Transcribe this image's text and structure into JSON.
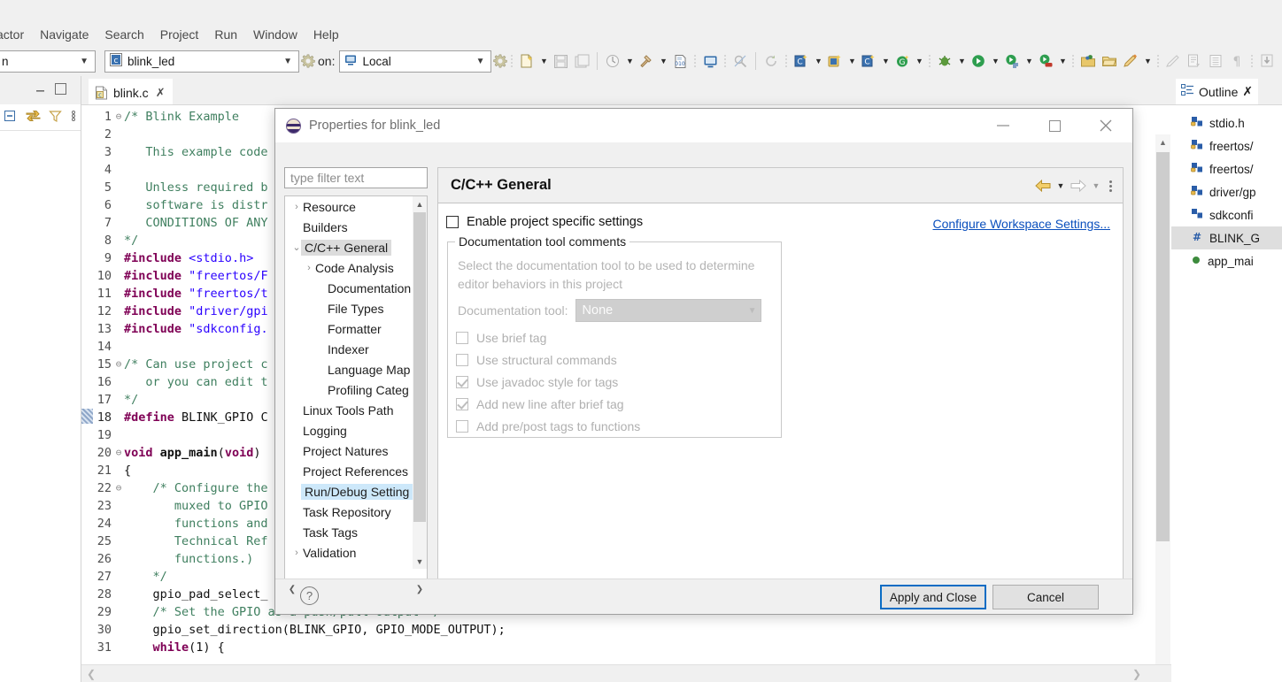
{
  "menubar": {
    "items": [
      "actor",
      "Navigate",
      "Search",
      "Project",
      "Run",
      "Window",
      "Help"
    ]
  },
  "toolbar": {
    "perspective_combo_value": "n",
    "launch_combo_value": "blink_led",
    "on_label": "on:",
    "target_combo_value": "Local",
    "icons": [
      "new-file-icon",
      "save-icon",
      "save-all-icon",
      "quick-access-icon",
      "build-hammer-icon",
      "binary-icon",
      "console-icon",
      "search-disabled-icon",
      "refresh-icon",
      "new-c-project-icon",
      "new-c-class-icon",
      "new-c-file-icon",
      "new-generic-icon",
      "debug-bug-icon",
      "run-icon",
      "run-config-icon",
      "stop-record-icon",
      "open-type-icon",
      "open-folder-icon",
      "pencil-icon",
      "highlight-icon",
      "export-icon",
      "list-icon",
      "pilcrow-icon",
      "download-icon"
    ]
  },
  "left_pane": {
    "tools": [
      "collapse-all-icon",
      "link-with-editor-icon",
      "filter-icon",
      "view-menu-icon"
    ],
    "window_buttons": [
      "minimize-icon",
      "maximize-icon"
    ]
  },
  "editor": {
    "tab_label": "blink.c",
    "tab_close": "✗",
    "file_icon": "c-file-icon",
    "lines": [
      {
        "n": 1,
        "fold": "⊖",
        "segs": [
          {
            "t": "/* Blink Example",
            "c": "cm"
          }
        ]
      },
      {
        "n": 2,
        "fold": "",
        "segs": []
      },
      {
        "n": 3,
        "fold": "",
        "segs": [
          {
            "t": "   This example code",
            "c": "cm"
          }
        ]
      },
      {
        "n": 4,
        "fold": "",
        "segs": []
      },
      {
        "n": 5,
        "fold": "",
        "segs": [
          {
            "t": "   Unless required b",
            "c": "cm"
          }
        ]
      },
      {
        "n": 6,
        "fold": "",
        "segs": [
          {
            "t": "   software is distr",
            "c": "cm"
          }
        ]
      },
      {
        "n": 7,
        "fold": "",
        "segs": [
          {
            "t": "   CONDITIONS OF ANY",
            "c": "cm"
          }
        ]
      },
      {
        "n": 8,
        "fold": "",
        "segs": [
          {
            "t": "*/",
            "c": "cm"
          }
        ]
      },
      {
        "n": 9,
        "fold": "",
        "segs": [
          {
            "t": "#include",
            "c": "pp"
          },
          {
            "t": " ",
            "c": ""
          },
          {
            "t": "<stdio.h>",
            "c": "str"
          }
        ]
      },
      {
        "n": 10,
        "fold": "",
        "segs": [
          {
            "t": "#include",
            "c": "pp"
          },
          {
            "t": " ",
            "c": ""
          },
          {
            "t": "\"freertos/F",
            "c": "str"
          }
        ]
      },
      {
        "n": 11,
        "fold": "",
        "segs": [
          {
            "t": "#include",
            "c": "pp"
          },
          {
            "t": " ",
            "c": ""
          },
          {
            "t": "\"freertos/t",
            "c": "str"
          }
        ]
      },
      {
        "n": 12,
        "fold": "",
        "segs": [
          {
            "t": "#include",
            "c": "pp"
          },
          {
            "t": " ",
            "c": ""
          },
          {
            "t": "\"driver/gpi",
            "c": "str"
          }
        ]
      },
      {
        "n": 13,
        "fold": "",
        "segs": [
          {
            "t": "#include",
            "c": "pp"
          },
          {
            "t": " ",
            "c": ""
          },
          {
            "t": "\"sdkconfig.",
            "c": "str"
          }
        ]
      },
      {
        "n": 14,
        "fold": "",
        "segs": []
      },
      {
        "n": 15,
        "fold": "⊖",
        "segs": [
          {
            "t": "/* Can use project c",
            "c": "cm"
          }
        ]
      },
      {
        "n": 16,
        "fold": "",
        "segs": [
          {
            "t": "   or you can edit t",
            "c": "cm"
          }
        ]
      },
      {
        "n": 17,
        "fold": "",
        "segs": [
          {
            "t": "*/",
            "c": "cm"
          }
        ]
      },
      {
        "n": 18,
        "fold": "",
        "current": true,
        "segs": [
          {
            "t": "#define",
            "c": "pp"
          },
          {
            "t": " BLINK_GPIO C",
            "c": ""
          }
        ]
      },
      {
        "n": 19,
        "fold": "",
        "segs": []
      },
      {
        "n": 20,
        "fold": "⊖",
        "segs": [
          {
            "t": "void",
            "c": "kw"
          },
          {
            "t": " ",
            "c": ""
          },
          {
            "t": "app_main",
            "c": "fn"
          },
          {
            "t": "(",
            "c": ""
          },
          {
            "t": "void",
            "c": "kw"
          },
          {
            "t": ")",
            "c": ""
          }
        ]
      },
      {
        "n": 21,
        "fold": "",
        "segs": [
          {
            "t": "{",
            "c": ""
          }
        ]
      },
      {
        "n": 22,
        "fold": "⊖",
        "segs": [
          {
            "t": "    /* Configure the",
            "c": "cm"
          }
        ]
      },
      {
        "n": 23,
        "fold": "",
        "segs": [
          {
            "t": "       muxed to GPIO",
            "c": "cm"
          }
        ]
      },
      {
        "n": 24,
        "fold": "",
        "segs": [
          {
            "t": "       functions and",
            "c": "cm"
          }
        ]
      },
      {
        "n": 25,
        "fold": "",
        "segs": [
          {
            "t": "       Technical Ref",
            "c": "cm"
          }
        ]
      },
      {
        "n": 26,
        "fold": "",
        "segs": [
          {
            "t": "       functions.)",
            "c": "cm"
          }
        ]
      },
      {
        "n": 27,
        "fold": "",
        "segs": [
          {
            "t": "    */",
            "c": "cm"
          }
        ]
      },
      {
        "n": 28,
        "fold": "",
        "segs": [
          {
            "t": "    gpio_pad_select_",
            "c": ""
          }
        ]
      },
      {
        "n": 29,
        "fold": "",
        "segs": [
          {
            "t": "    /* Set the GPIO as a push/pull output */",
            "c": "cm"
          }
        ]
      },
      {
        "n": 30,
        "fold": "",
        "segs": [
          {
            "t": "    gpio_set_direction(BLINK_GPIO, GPIO_MODE_OUTPUT);",
            "c": ""
          }
        ]
      },
      {
        "n": 31,
        "fold": "",
        "segs": [
          {
            "t": "    while",
            "c": "kw"
          },
          {
            "t": "(1) {",
            "c": ""
          }
        ]
      }
    ]
  },
  "outline": {
    "tab_label": "Outline",
    "tab_close": "✗",
    "items": [
      {
        "label": "stdio.h",
        "icon": "include-icon",
        "selected": false
      },
      {
        "label": "freertos/",
        "icon": "include-icon",
        "selected": false
      },
      {
        "label": "freertos/",
        "icon": "include-icon",
        "selected": false
      },
      {
        "label": "driver/gp",
        "icon": "include-icon",
        "selected": false
      },
      {
        "label": "sdkconfi",
        "icon": "include-plain-icon",
        "selected": false
      },
      {
        "label": "BLINK_G",
        "icon": "define-hash-icon",
        "selected": true
      },
      {
        "label": "app_mai",
        "icon": "function-dot-icon",
        "selected": false
      }
    ]
  },
  "dialog": {
    "title": "Properties for blink_led",
    "window_buttons": [
      "minimize-icon",
      "maximize-icon",
      "close-icon"
    ],
    "filter_placeholder": "type filter text",
    "tree": [
      {
        "label": "Resource",
        "indent": 0,
        "twisty": "›",
        "state": "none"
      },
      {
        "label": "Builders",
        "indent": 0,
        "twisty": "",
        "state": "none"
      },
      {
        "label": "C/C++ General",
        "indent": 0,
        "twisty": "⌄",
        "state": "grey"
      },
      {
        "label": "Code Analysis",
        "indent": 1,
        "twisty": "›",
        "state": "none"
      },
      {
        "label": "Documentation",
        "indent": 2,
        "twisty": "",
        "state": "none"
      },
      {
        "label": "File Types",
        "indent": 2,
        "twisty": "",
        "state": "none"
      },
      {
        "label": "Formatter",
        "indent": 2,
        "twisty": "",
        "state": "none"
      },
      {
        "label": "Indexer",
        "indent": 2,
        "twisty": "",
        "state": "none"
      },
      {
        "label": "Language Map",
        "indent": 2,
        "twisty": "",
        "state": "none"
      },
      {
        "label": "Profiling Categ",
        "indent": 2,
        "twisty": "",
        "state": "none"
      },
      {
        "label": "Linux Tools Path",
        "indent": 0,
        "twisty": "",
        "state": "none"
      },
      {
        "label": "Logging",
        "indent": 0,
        "twisty": "",
        "state": "none"
      },
      {
        "label": "Project Natures",
        "indent": 0,
        "twisty": "",
        "state": "none"
      },
      {
        "label": "Project References",
        "indent": 0,
        "twisty": "",
        "state": "none"
      },
      {
        "label": "Run/Debug Setting",
        "indent": 0,
        "twisty": "",
        "state": "blue"
      },
      {
        "label": "Task Repository",
        "indent": 0,
        "twisty": "",
        "state": "none"
      },
      {
        "label": "Task Tags",
        "indent": 0,
        "twisty": "",
        "state": "none"
      },
      {
        "label": "Validation",
        "indent": 0,
        "twisty": "›",
        "state": "none"
      }
    ],
    "page": {
      "title": "C/C++ General",
      "nav_back_icon": "back-arrow-icon",
      "nav_forward_icon": "forward-arrow-icon",
      "menu_icon": "view-menu-icon",
      "enable_project_specific": "Enable project specific settings",
      "enable_project_specific_checked": false,
      "configure_workspace_link": "Configure Workspace Settings...",
      "group_label": "Documentation tool comments",
      "group_description": "Select the documentation tool to be used to determine editor behaviors in this project",
      "doc_tool_label": "Documentation tool:",
      "doc_tool_value": "None",
      "checkboxes": [
        {
          "label": "Use brief tag",
          "checked": false,
          "disabled": true
        },
        {
          "label": "Use structural commands",
          "checked": false,
          "disabled": true
        },
        {
          "label": "Use javadoc style for tags",
          "checked": true,
          "disabled": true
        },
        {
          "label": "Add new line after brief tag",
          "checked": true,
          "disabled": true
        },
        {
          "label": "Add pre/post tags to functions",
          "checked": false,
          "disabled": true
        }
      ]
    },
    "footer": {
      "help_icon": "help-icon",
      "apply_label": "Apply and Close",
      "cancel_label": "Cancel"
    }
  },
  "colors": {
    "accent_blue": "#0a6cc4",
    "link_blue": "#0a4fbd",
    "comment_green": "#3f7f5f",
    "preproc_purple": "#7f0055",
    "string_blue": "#2a00ff",
    "selection_blue": "#cde8fa",
    "chrome_grey": "#f0f0f0"
  }
}
